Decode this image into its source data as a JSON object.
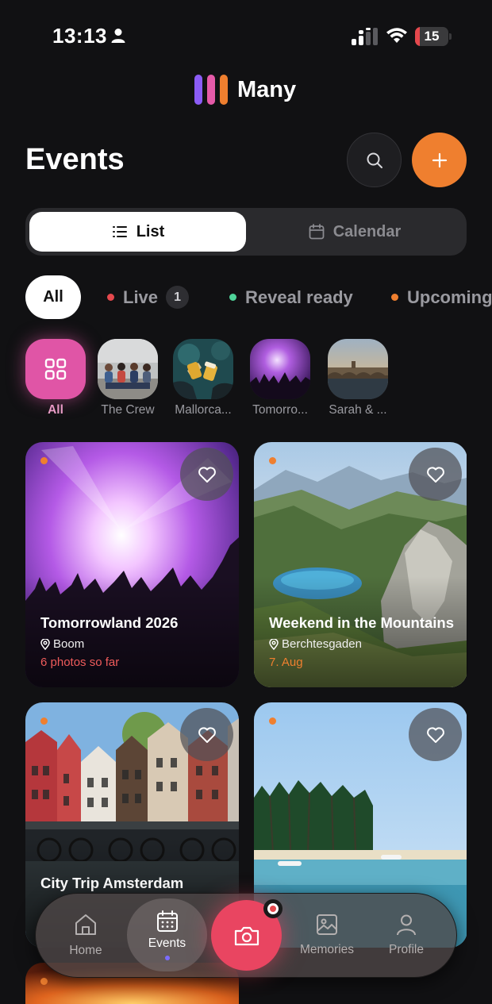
{
  "status_bar": {
    "time": "13:13",
    "battery": "15",
    "battery_level": 0.15
  },
  "app": {
    "name": "Many",
    "logo_colors": [
      "#8b5cf6",
      "#e55aa8",
      "#ef7f2f"
    ]
  },
  "header": {
    "title": "Events"
  },
  "view_toggle": {
    "list_label": "List",
    "calendar_label": "Calendar",
    "selected": "List"
  },
  "filters": {
    "all_label": "All",
    "items": [
      {
        "label": "Live",
        "dot_color": "#e5484d",
        "count": "1"
      },
      {
        "label": "Reveal ready",
        "dot_color": "#4fd49a"
      },
      {
        "label": "Upcoming",
        "dot_color": "#ef7f2f"
      }
    ]
  },
  "groups": [
    {
      "label": "All",
      "icon": "grid-icon",
      "selected": true
    },
    {
      "label": "The Crew"
    },
    {
      "label": "Mallorca..."
    },
    {
      "label": "Tomorro..."
    },
    {
      "label": "Sarah & ..."
    }
  ],
  "events": [
    {
      "title": "Tomorrowland 2026",
      "location": "Boom",
      "meta": "6 photos so far",
      "meta_color": "#ef5b5b",
      "status_color": "#ef7f2f"
    },
    {
      "title": "Weekend in the Mountains",
      "location": "Berchtesgaden",
      "meta": "7. Aug",
      "meta_color": "#ef7f2f",
      "status_color": "#ef7f2f"
    },
    {
      "title": "City Trip Amsterdam",
      "location": "",
      "meta": "",
      "status_color": "#ef7f2f"
    },
    {
      "title": "",
      "location": "",
      "meta": "",
      "status_color": "#ef7f2f"
    },
    {
      "title": "",
      "location": "",
      "meta": "",
      "status_color": "#ef7f2f"
    }
  ],
  "nav": {
    "home": "Home",
    "events": "Events",
    "memories": "Memories",
    "profile": "Profile",
    "active": "Events"
  }
}
